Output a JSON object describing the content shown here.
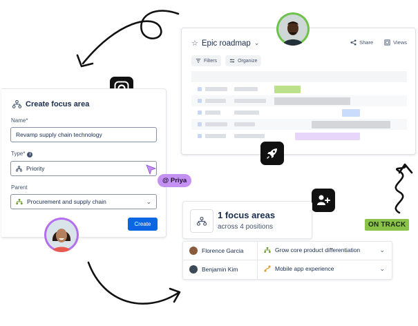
{
  "roadmap": {
    "title": "Epic roadmap",
    "share_label": "Share",
    "views_label": "Views",
    "filters_label": "Filters",
    "organize_label": "Organize"
  },
  "form": {
    "title": "Create focus area",
    "name_label": "Name*",
    "name_value": "Revamp supply chain technology",
    "type_label": "Type*",
    "type_value": "Priority",
    "parent_label": "Parent",
    "parent_value": "Procurement and supply chain",
    "create_label": "Create"
  },
  "mention": "@ Priya",
  "status_badge": "ON TRACK",
  "focus_summary": {
    "title": "1 focus areas",
    "subtitle": "across 4 positions"
  },
  "assignments": [
    {
      "person": "Florence Garcia",
      "area": "Grow core product differentiation"
    },
    {
      "person": "Benjamin Kim",
      "area": "Mobile app experience"
    }
  ],
  "colors": {
    "primary_button": "#0c66e4",
    "mention_bg": "#c491f2",
    "status_bg": "#8bc34a",
    "avatar_ring": "#6cc24a",
    "avatar_ring_purple": "#b56ef0"
  }
}
